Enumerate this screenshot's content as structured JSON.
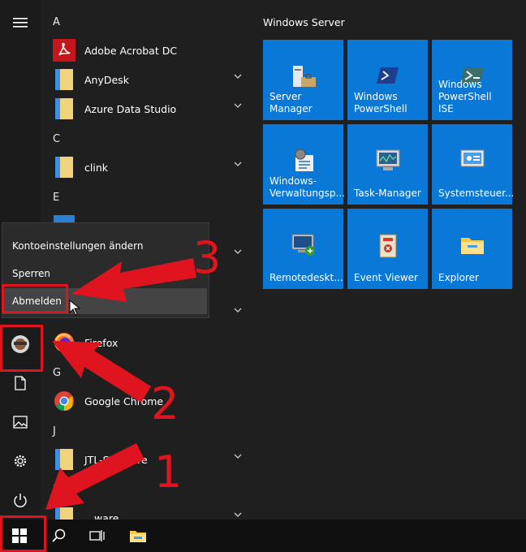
{
  "start_menu": {
    "apps": [
      {
        "letter": "A"
      },
      {
        "label": "Adobe Acrobat DC",
        "icon": "acrobat-icon"
      },
      {
        "label": "AnyDesk",
        "icon": "folder-icon"
      },
      {
        "label": "Azure Data Studio",
        "icon": "folder-icon"
      },
      {
        "letter": "C"
      },
      {
        "label": "clink",
        "icon": "folder-icon"
      },
      {
        "letter": "E"
      },
      {
        "label": "Firefox",
        "icon": "firefox-icon"
      },
      {
        "letter": "G"
      },
      {
        "label": "Google Chrome",
        "icon": "chrome-icon"
      },
      {
        "letter": "J"
      },
      {
        "label": "JTL-Software",
        "icon": "folder-icon"
      },
      {
        "letter": "L"
      },
      {
        "label": "...ware",
        "icon": "folder-icon"
      }
    ],
    "letters": {
      "a": "A",
      "c": "C",
      "e": "E",
      "g": "G",
      "j": "J",
      "l": "L"
    },
    "labels": {
      "acrobat": "Adobe Acrobat DC",
      "anydesk": "AnyDesk",
      "azure": "Azure Data Studio",
      "clink": "clink",
      "firefox": "Firefox",
      "chrome": "Google Chrome",
      "jtl": "JTL-Software",
      "lware": "ware"
    }
  },
  "account_menu": {
    "change_settings": "Kontoeinstellungen ändern",
    "lock": "Sperren",
    "sign_out": "Abmelden"
  },
  "tiles_group": {
    "title": "Windows Server",
    "tiles": [
      {
        "label": "Server Manager",
        "icon": "server-manager-icon"
      },
      {
        "label": "Windows PowerShell",
        "icon": "powershell-icon"
      },
      {
        "label": "Windows PowerShell ISE",
        "icon": "powershell-ise-icon"
      },
      {
        "label": "Windows-Verwaltungsp...",
        "icon": "admin-tools-icon"
      },
      {
        "label": "Task-Manager",
        "icon": "task-manager-icon"
      },
      {
        "label": "Systemsteuer...",
        "icon": "control-panel-icon"
      },
      {
        "label": "Remotedeskt...",
        "icon": "remote-desktop-icon"
      },
      {
        "label": "Event Viewer",
        "icon": "event-viewer-icon"
      },
      {
        "label": "Explorer",
        "icon": "explorer-icon"
      }
    ],
    "t": {
      "server_manager": "Server Manager",
      "ps1": "Windows",
      "ps2": "PowerShell",
      "ise1": "Windows",
      "ise2": "PowerShell ISE",
      "wv1": "Windows-",
      "wv2": "Verwaltungsp...",
      "taskmgr": "Task-Manager",
      "sysctl": "Systemsteuer...",
      "rdp": "Remotedeskt...",
      "event": "Event Viewer",
      "explorer": "Explorer"
    }
  },
  "annotations": {
    "n1": "1",
    "n2": "2",
    "n3": "3"
  },
  "colors": {
    "tile_blue": "#0a78d7",
    "annotation_red": "#e0141e"
  }
}
